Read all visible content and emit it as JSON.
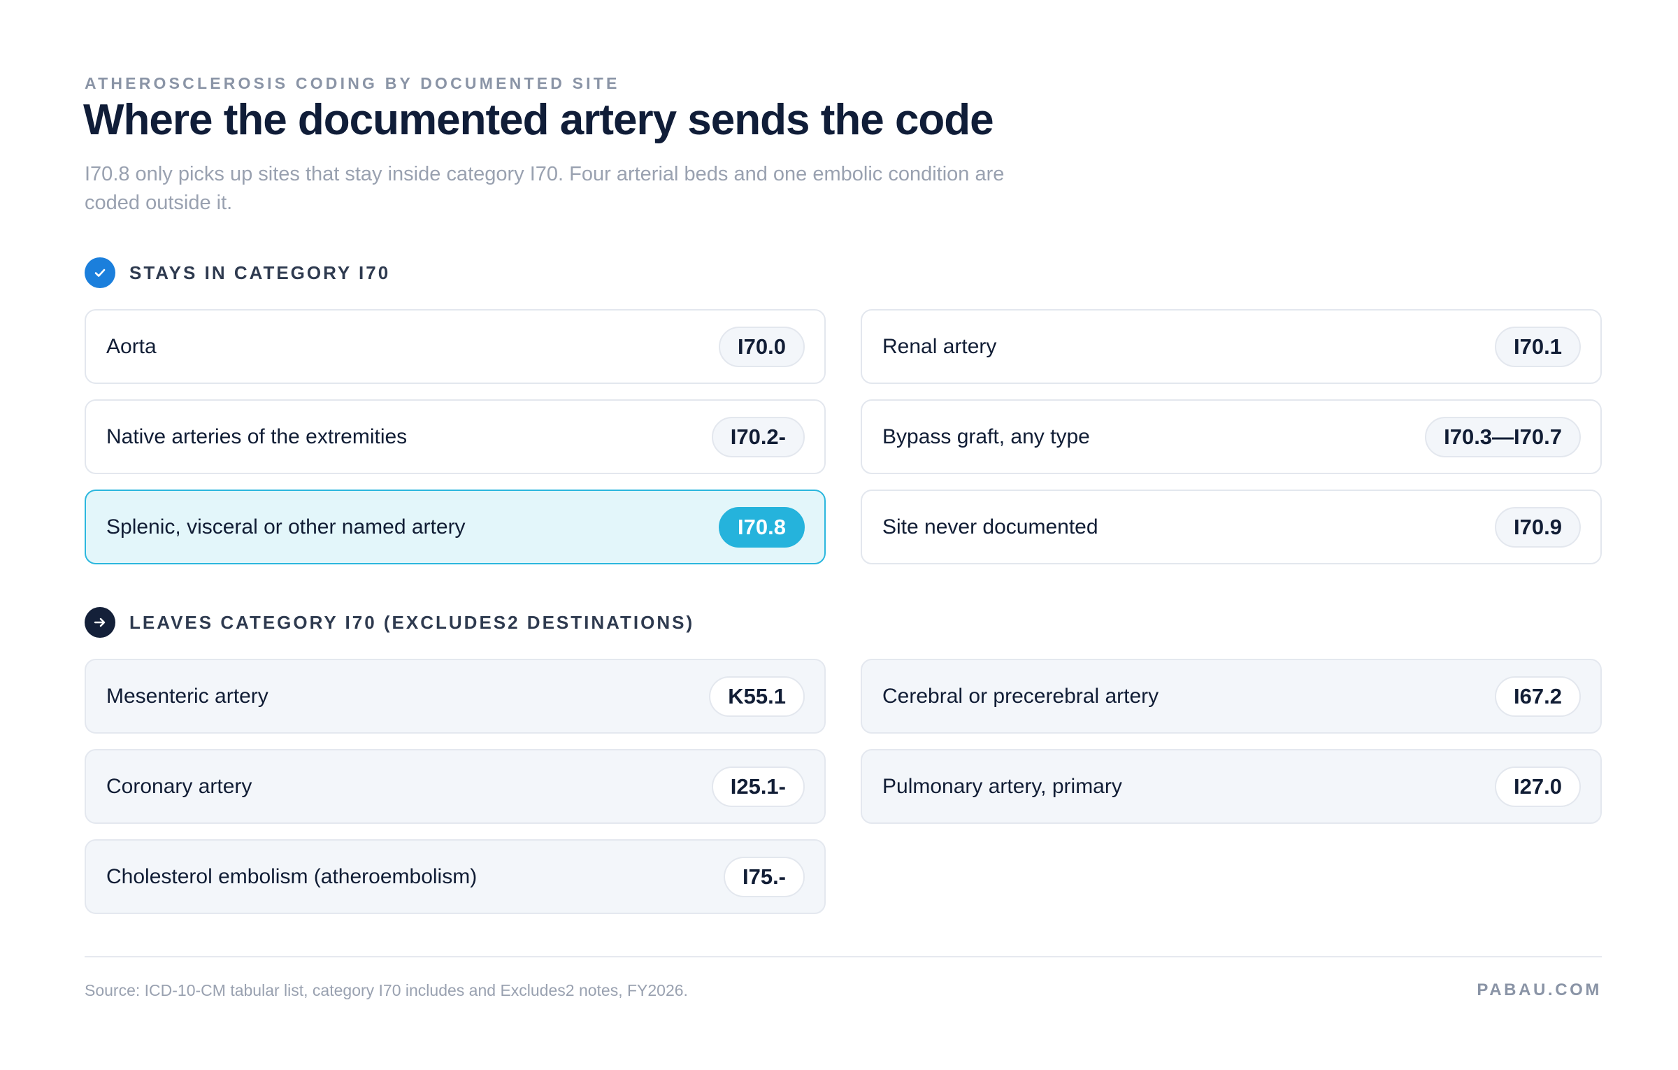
{
  "header": {
    "eyebrow": "ATHEROSCLEROSIS CODING BY DOCUMENTED SITE",
    "title": "Where the documented artery sends the code",
    "subtitle": "I70.8 only picks up sites that stay inside category I70. Four arterial beds and one embolic condition are coded outside it."
  },
  "stays": {
    "label": "STAYS IN CATEGORY I70",
    "icon": "check-icon",
    "accent": "#1b7fdc",
    "rows": [
      {
        "label": "Aorta",
        "code": "I70.0"
      },
      {
        "label": "Renal artery",
        "code": "I70.1"
      },
      {
        "label": "Native arteries of the extremities",
        "code": "I70.2-"
      },
      {
        "label": "Bypass graft, any type",
        "code": "I70.3—I70.7"
      },
      {
        "label": "Splenic, visceral or other named artery",
        "code": "I70.8",
        "highlight": true
      },
      {
        "label": "Site never documented",
        "code": "I70.9"
      }
    ]
  },
  "leaves": {
    "label": "LEAVES CATEGORY I70 (EXCLUDES2 DESTINATIONS)",
    "icon": "arrow-right-icon",
    "accent": "#142039",
    "rows": [
      {
        "label": "Mesenteric artery",
        "code": "K55.1"
      },
      {
        "label": "Cerebral or precerebral artery",
        "code": "I67.2"
      },
      {
        "label": "Coronary artery",
        "code": "I25.1-"
      },
      {
        "label": "Pulmonary artery, primary",
        "code": "I27.0"
      },
      {
        "label": "Cholesterol embolism (atheroembolism)",
        "code": "I75.-"
      }
    ]
  },
  "highlight_color": "#25b3dc",
  "footer": {
    "source": "Source: ICD-10-CM tabular list, category I70 includes and Excludes2 notes, FY2026.",
    "brand": "PABAU.COM"
  }
}
